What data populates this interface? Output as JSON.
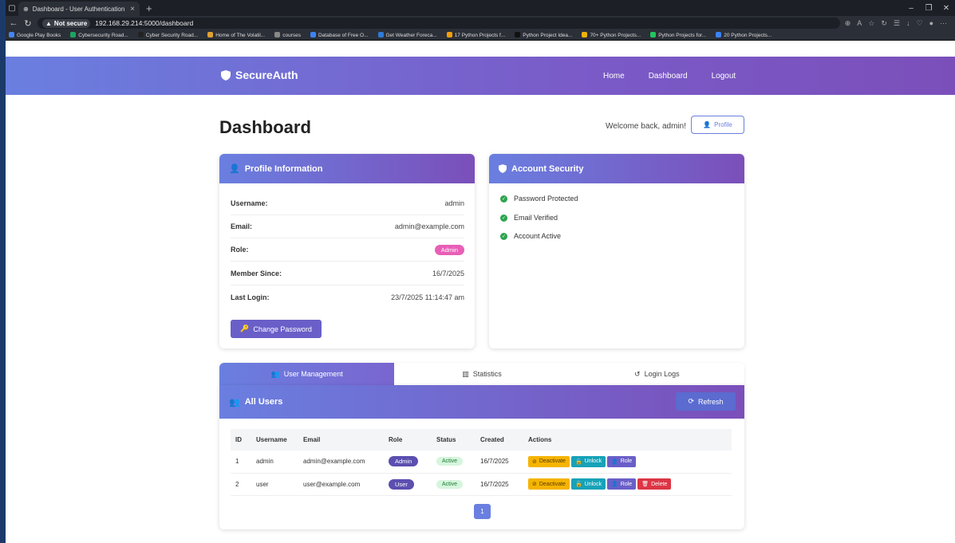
{
  "browser": {
    "tab_title": "Dashboard - User Authentication",
    "not_secure_label": "Not secure",
    "url": "192.168.29.214:5000/dashboard",
    "bookmarks": [
      "Google Play Books",
      "Cybersecurity Road...",
      "Cyber Security Road...",
      "Home of The Volatil...",
      "courses",
      "Database of Free O...",
      "Get Weather Foreca...",
      "17 Python Projects f...",
      "Python Project Idea...",
      "70+ Python Projects...",
      "Python Projects for...",
      "20 Python Projects..."
    ]
  },
  "app": {
    "brand": "SecureAuth",
    "nav": [
      "Home",
      "Dashboard",
      "Logout"
    ],
    "page_title": "Dashboard",
    "welcome": "Welcome back, admin!",
    "profile_button": "Profile"
  },
  "profile": {
    "title": "Profile Information",
    "rows": [
      {
        "label": "Username:",
        "value": "admin"
      },
      {
        "label": "Email:",
        "value": "admin@example.com"
      },
      {
        "label": "Role:",
        "value": "Admin"
      },
      {
        "label": "Member Since:",
        "value": "16/7/2025"
      },
      {
        "label": "Last Login:",
        "value": "23/7/2025 11:14:47 am"
      }
    ],
    "change_password": "Change Password"
  },
  "security": {
    "title": "Account Security",
    "items": [
      "Password Protected",
      "Email Verified",
      "Account Active"
    ]
  },
  "tabs": [
    "User Management",
    "Statistics",
    "Login Logs"
  ],
  "users": {
    "title": "All Users",
    "refresh": "Refresh",
    "columns": [
      "ID",
      "Username",
      "Email",
      "Role",
      "Status",
      "Created",
      "Actions"
    ],
    "rows": [
      {
        "id": "1",
        "username": "admin",
        "email": "admin@example.com",
        "role": "Admin",
        "status": "Active",
        "created": "16/7/2025",
        "actions": [
          "Deactivate",
          "Unlock",
          "Role"
        ]
      },
      {
        "id": "2",
        "username": "user",
        "email": "user@example.com",
        "role": "User",
        "status": "Active",
        "created": "16/7/2025",
        "actions": [
          "Deactivate",
          "Unlock",
          "Role",
          "Delete"
        ]
      }
    ],
    "page": "1"
  },
  "colors": {
    "accent": "#6a7fe0",
    "accent2": "#7b4fba",
    "admin_badge": "#e85fb6",
    "user_badge": "#5b4fb0",
    "deactivate": "#f5b400",
    "unlock": "#17a2b8",
    "role": "#6a5fc8",
    "delete": "#dc3545"
  }
}
